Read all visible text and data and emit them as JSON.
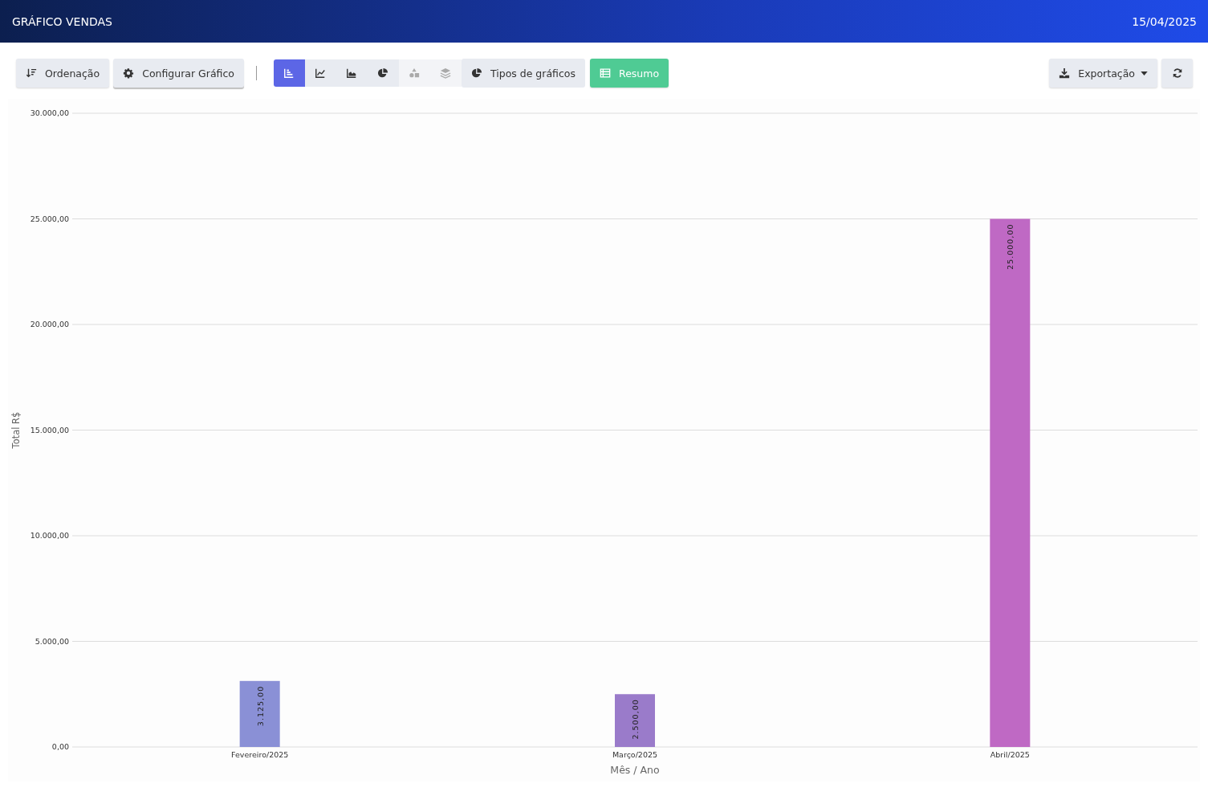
{
  "header": {
    "title": "GRÁFICO VENDAS",
    "date": "15/04/2025"
  },
  "toolbar": {
    "sort_button": "Ordenação",
    "config_button": "Configurar Gráfico",
    "chart_types": [
      {
        "kind": "bar",
        "selected": true,
        "disabled": false
      },
      {
        "kind": "line",
        "selected": false,
        "disabled": false
      },
      {
        "kind": "area",
        "selected": false,
        "disabled": false
      },
      {
        "kind": "pie",
        "selected": false,
        "disabled": false
      },
      {
        "kind": "shapes",
        "selected": false,
        "disabled": true
      },
      {
        "kind": "layers",
        "selected": false,
        "disabled": true
      }
    ],
    "types_button": "Tipos de gráficos",
    "summary_button": "Resumo",
    "export_button": "Exportação"
  },
  "chart": {
    "chart_data": {
      "type": "bar",
      "xlabel": "Mês / Ano",
      "ylabel": "Total R$",
      "categories": [
        "Fevereiro/2025",
        "Março/2025",
        "Abril/2025"
      ],
      "series": [
        {
          "color": "#8a90d6",
          "values": [
            3125,
            null,
            null
          ]
        },
        {
          "color": "#9a7bca",
          "values": [
            null,
            2500,
            null
          ]
        },
        {
          "color": "#bf69c4",
          "values": [
            null,
            null,
            25000
          ]
        }
      ],
      "stacked": true,
      "grid": true,
      "ylim": [
        0,
        30000
      ],
      "yticks": [
        {
          "value": 0,
          "label": "0,00"
        },
        {
          "value": 5000,
          "label": "5.000,00"
        },
        {
          "value": 10000,
          "label": "10.000,00"
        },
        {
          "value": 15000,
          "label": "15.000,00"
        },
        {
          "value": 20000,
          "label": "20.000,00"
        },
        {
          "value": 25000,
          "label": "25.000,00"
        },
        {
          "value": 30000,
          "label": "30.000,00"
        }
      ],
      "value_labels": [
        "3.125,00",
        "2.500,00",
        "25.000,00"
      ]
    }
  }
}
